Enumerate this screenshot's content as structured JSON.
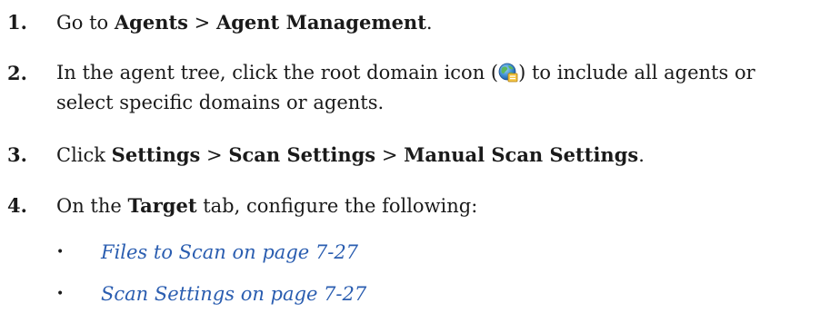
{
  "steps": [
    {
      "number": "1.",
      "prefix": "Go to ",
      "bold1": "Agents",
      "sep1": " > ",
      "bold2": "Agent Management",
      "suffix": "."
    },
    {
      "number": "2.",
      "line1_before_icon": "In the agent tree, click the root domain icon (",
      "icon": "root-domain-globe-icon",
      "line1_after_icon": ") to include all agents or",
      "line2": "select specific domains or agents."
    },
    {
      "number": "3.",
      "prefix": "Click ",
      "bold1": "Settings",
      "sep1": " > ",
      "bold2": "Scan Settings",
      "sep2": " > ",
      "bold3": "Manual Scan Settings",
      "suffix": "."
    },
    {
      "number": "4.",
      "prefix": "On the ",
      "bold1": "Target",
      "suffix": " tab, configure the following:"
    }
  ],
  "links": [
    {
      "bullet": "•",
      "text": "Files to Scan on page 7-27"
    },
    {
      "bullet": "•",
      "text": "Scan Settings on page 7-27"
    }
  ],
  "colors": {
    "text": "#1a1a1a",
    "link": "#2a5db0"
  }
}
